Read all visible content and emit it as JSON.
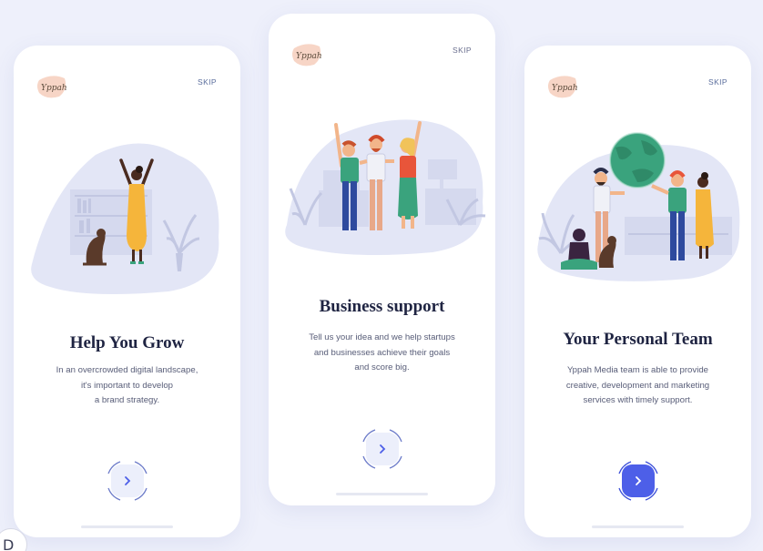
{
  "screens": [
    {
      "skip_label": "SKIP",
      "logo_text": "Yppah",
      "title": "Help You Grow",
      "description_lines": [
        "In an overcrowded digital landscape,",
        "it's important to develop",
        "a brand strategy."
      ],
      "next_icon": "chevron-right-icon",
      "next_active": false
    },
    {
      "skip_label": "SKIP",
      "logo_text": "Yppah",
      "title": "Business support",
      "description_lines": [
        "Tell us your idea and we help startups",
        "and businesses achieve their goals",
        "and score big."
      ],
      "next_icon": "chevron-right-icon",
      "next_active": false
    },
    {
      "skip_label": "SKIP",
      "logo_text": "Yppah",
      "title": "Your Personal Team",
      "description_lines": [
        "Yppah Media team is able to provide",
        "creative, development and marketing",
        "services with timely support."
      ],
      "next_icon": "chevron-right-icon",
      "next_active": true
    }
  ],
  "colors": {
    "background": "#eef0fb",
    "accent": "#4d5fe8",
    "blob": "#e3e6f6",
    "logo_peach": "#f7d5c6",
    "title_text": "#1f2442"
  }
}
